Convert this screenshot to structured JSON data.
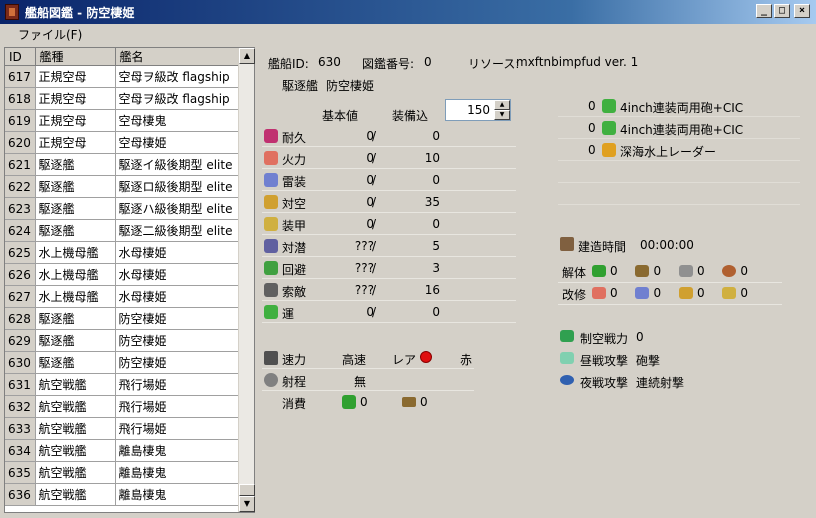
{
  "window": {
    "title": "艦船図鑑 - 防空棲姫"
  },
  "menu": [
    {
      "label": "ファイル(F)"
    }
  ],
  "list": {
    "columns": [
      "ID",
      "艦種",
      "艦名"
    ],
    "rows": [
      [
        "617",
        "正規空母",
        "空母ヲ級改 flagship"
      ],
      [
        "618",
        "正規空母",
        "空母ヲ級改 flagship"
      ],
      [
        "619",
        "正規空母",
        "空母棲鬼"
      ],
      [
        "620",
        "正規空母",
        "空母棲姫"
      ],
      [
        "621",
        "駆逐艦",
        "駆逐イ級後期型 elite"
      ],
      [
        "622",
        "駆逐艦",
        "駆逐ロ級後期型 elite"
      ],
      [
        "623",
        "駆逐艦",
        "駆逐ハ級後期型 elite"
      ],
      [
        "624",
        "駆逐艦",
        "駆逐二級後期型 elite"
      ],
      [
        "625",
        "水上機母艦",
        "水母棲姫"
      ],
      [
        "626",
        "水上機母艦",
        "水母棲姫"
      ],
      [
        "627",
        "水上機母艦",
        "水母棲姫"
      ],
      [
        "628",
        "駆逐艦",
        "防空棲姫"
      ],
      [
        "629",
        "駆逐艦",
        "防空棲姫"
      ],
      [
        "630",
        "駆逐艦",
        "防空棲姫"
      ],
      [
        "631",
        "航空戦艦",
        "飛行場姫"
      ],
      [
        "632",
        "航空戦艦",
        "飛行場姫"
      ],
      [
        "633",
        "航空戦艦",
        "飛行場姫"
      ],
      [
        "634",
        "航空戦艦",
        "離島棲鬼"
      ],
      [
        "635",
        "航空戦艦",
        "離島棲鬼"
      ],
      [
        "636",
        "航空戦艦",
        "離島棲鬼"
      ]
    ]
  },
  "detail": {
    "ship_id_label": "艦船ID:",
    "ship_id": "630",
    "album_no_label": "図鑑番号:",
    "album_no": "0",
    "resource_label": "リソース:",
    "resource": "mxftnbimpfud ver. 1",
    "ship_type": "駆逐艦",
    "ship_name": "防空棲姫",
    "header_base": "基本値",
    "header_equip": "装備込",
    "level": "150",
    "stats": [
      {
        "name": "耐久",
        "base": "0",
        "equip": "0",
        "icon": "heart-icon",
        "color": "#c03070"
      },
      {
        "name": "火力",
        "base": "0",
        "equip": "10",
        "icon": "firepower-icon",
        "color": "#e07060"
      },
      {
        "name": "雷装",
        "base": "0",
        "equip": "0",
        "icon": "torpedo-icon",
        "color": "#7080d0"
      },
      {
        "name": "対空",
        "base": "0",
        "equip": "35",
        "icon": "antiair-icon",
        "color": "#d0a030"
      },
      {
        "name": "装甲",
        "base": "0",
        "equip": "0",
        "icon": "armor-icon",
        "color": "#d0b040"
      },
      {
        "name": "対潜",
        "base": "???",
        "equip": "5",
        "icon": "asw-icon",
        "color": "#6060a0"
      },
      {
        "name": "回避",
        "base": "???",
        "equip": "3",
        "icon": "evasion-icon",
        "color": "#40a040"
      },
      {
        "name": "索敵",
        "base": "???",
        "equip": "16",
        "icon": "los-icon",
        "color": "#606060"
      },
      {
        "name": "運",
        "base": "0",
        "equip": "0",
        "icon": "luck-icon",
        "color": "#40b040"
      }
    ],
    "slash": "/",
    "speed_label": "速力",
    "speed": "高速",
    "rarity_label": "レア",
    "rarity": "赤",
    "rarity_color": "#e01010",
    "range_label": "射程",
    "range": "無",
    "consume_label": "消費",
    "fuel": "0",
    "ammo": "0",
    "equipment": [
      {
        "count": "0",
        "name": "4inch連装両用砲+CIC",
        "icon": "gun-icon",
        "color": "#40b040"
      },
      {
        "count": "0",
        "name": "4inch連装両用砲+CIC",
        "icon": "gun-icon",
        "color": "#40b040"
      },
      {
        "count": "0",
        "name": "深海水上レーダー",
        "icon": "radar-icon",
        "color": "#e0a020"
      }
    ],
    "build_time_label": "建造時間",
    "build_time": "00:00:00",
    "dismantle_label": "解体",
    "dismantle": [
      "0",
      "0",
      "0",
      "0"
    ],
    "modernize_label": "改修",
    "modernize": [
      "0",
      "0",
      "0",
      "0"
    ],
    "air_power_label": "制空戦力",
    "air_power": "0",
    "day_attack_label": "昼戦攻撃",
    "day_attack": "砲撃",
    "night_attack_label": "夜戦攻撃",
    "night_attack": "連続射撃"
  }
}
